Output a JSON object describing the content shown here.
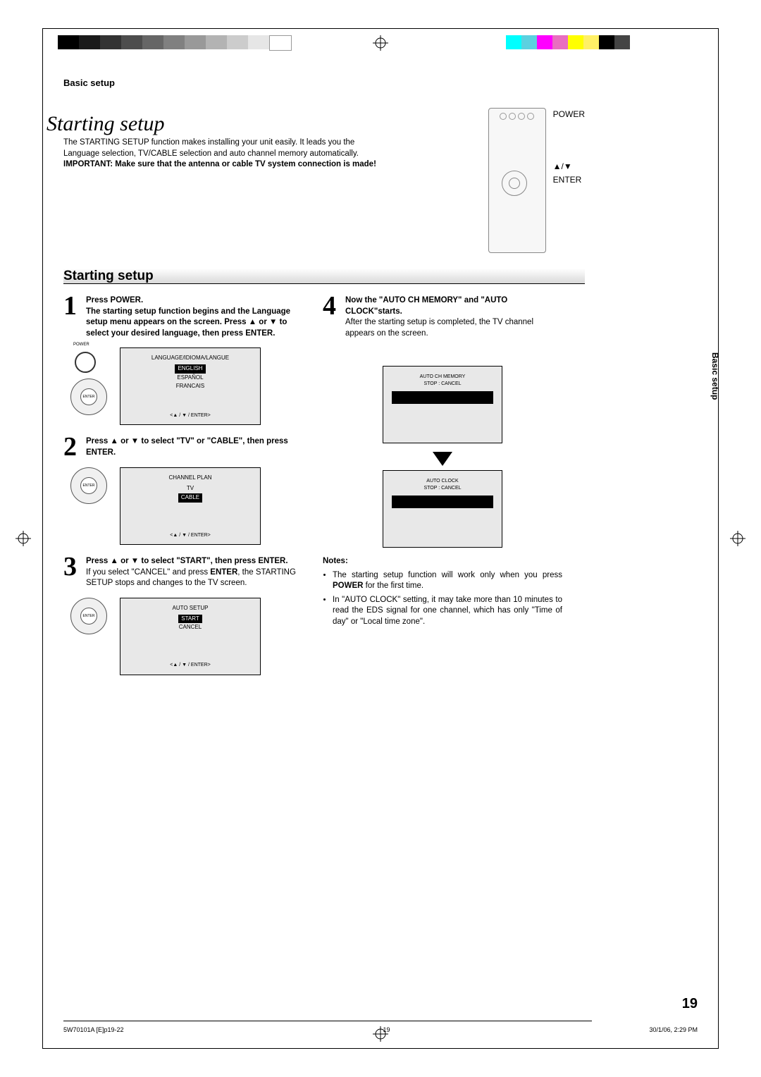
{
  "header": "Basic setup",
  "title": "Starting setup",
  "intro1": "The STARTING SETUP function makes installing your unit easily. It leads you the Language selection, TV/CABLE selection and auto channel memory automatically.",
  "intro2a": "IMPORTANT: Make sure that the antenna or cable TV system connection is made!",
  "remote": {
    "power": "POWER",
    "arrows": "▲/▼",
    "enter": "ENTER"
  },
  "section_title": "Starting setup",
  "side_tab": "Basic setup",
  "step1": {
    "num": "1",
    "l1": "Press POWER.",
    "l2": "The starting setup function begins and the Language setup menu appears on the screen. Press ▲ or ▼ to select your desired language, then press ENTER.",
    "scr_title": "LANGUAGE/IDIOMA/LANGUE",
    "opt1": "ENGLISH",
    "opt2": "ESPAÑOL",
    "opt3": "FRANCAIS",
    "scr_foot": "<▲ / ▼ / ENTER>",
    "pwr_label": "POWER",
    "enter_label": "ENTER"
  },
  "step2": {
    "num": "2",
    "l1": "Press ▲ or ▼ to select \"TV\" or \"CABLE\", then press ENTER.",
    "scr_title": "CHANNEL PLAN",
    "opt1": "TV",
    "opt2": "CABLE",
    "scr_foot": "<▲ / ▼ / ENTER>",
    "enter_label": "ENTER"
  },
  "step3": {
    "num": "3",
    "l1": "Press ▲ or ▼ to select \"START\", then press ENTER.",
    "l2a": "If you select \"CANCEL\" and press ",
    "l2b": "ENTER",
    "l2c": ", the STARTING SETUP stops and changes to the TV screen.",
    "scr_title": "AUTO SETUP",
    "opt1": "START",
    "opt2": "CANCEL",
    "scr_foot": "<▲ / ▼ / ENTER>",
    "enter_label": "ENTER"
  },
  "step4": {
    "num": "4",
    "l1": "Now the \"AUTO CH MEMORY\" and \"AUTO CLOCK\"starts.",
    "l2": "After the starting setup is completed, the TV channel appears on the screen.",
    "scr1_t": "AUTO CH MEMORY",
    "scr1_s": "STOP : CANCEL",
    "scr2_t": "AUTO CLOCK",
    "scr2_s": "STOP : CANCEL"
  },
  "notes": {
    "heading": "Notes:",
    "n1a": "The starting setup function will work only when you press ",
    "n1b": "POWER",
    "n1c": " for the first time.",
    "n2": "In \"AUTO CLOCK\" setting, it may take more than 10 minutes to read the EDS signal for one channel, which has only \"Time of day\" or \"Local time zone\"."
  },
  "page_num": "19",
  "footer": {
    "file": "5W70101A [E]p19-22",
    "pg": "19",
    "ts": "30/1/06, 2:29 PM"
  }
}
